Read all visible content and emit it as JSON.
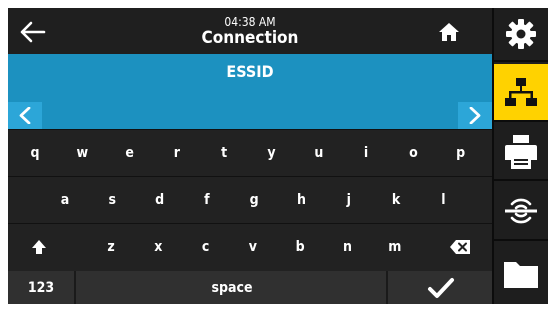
{
  "header": {
    "time": "04:38 AM",
    "title": "Connection",
    "back_icon": "arrow-left-icon",
    "home_icon": "home-icon"
  },
  "field": {
    "label": "ESSID",
    "prev_icon": "chevron-left-icon",
    "next_icon": "chevron-right-icon"
  },
  "keyboard": {
    "row1": [
      "q",
      "w",
      "e",
      "r",
      "t",
      "y",
      "u",
      "i",
      "o",
      "p"
    ],
    "row2": [
      "a",
      "s",
      "d",
      "f",
      "g",
      "h",
      "j",
      "k",
      "l"
    ],
    "row3": [
      "z",
      "x",
      "c",
      "v",
      "b",
      "n",
      "m"
    ],
    "shift_icon": "shift-arrow-icon",
    "backspace_icon": "backspace-icon",
    "numbers_label": "123",
    "space_label": "space",
    "enter_icon": "checkmark-icon"
  },
  "sidebar": {
    "items": [
      {
        "name": "settings",
        "icon": "gear-icon",
        "active": false
      },
      {
        "name": "network",
        "icon": "network-icon",
        "active": true
      },
      {
        "name": "printer",
        "icon": "printer-icon",
        "active": false
      },
      {
        "name": "sensor",
        "icon": "sensor-icon",
        "active": false
      },
      {
        "name": "storage",
        "icon": "folder-icon",
        "active": false
      }
    ]
  },
  "colors": {
    "accent": "#1c91c0",
    "arrow_bg": "#2ca6d8",
    "active_tab": "#ffd200",
    "background": "#1e1e1e"
  }
}
